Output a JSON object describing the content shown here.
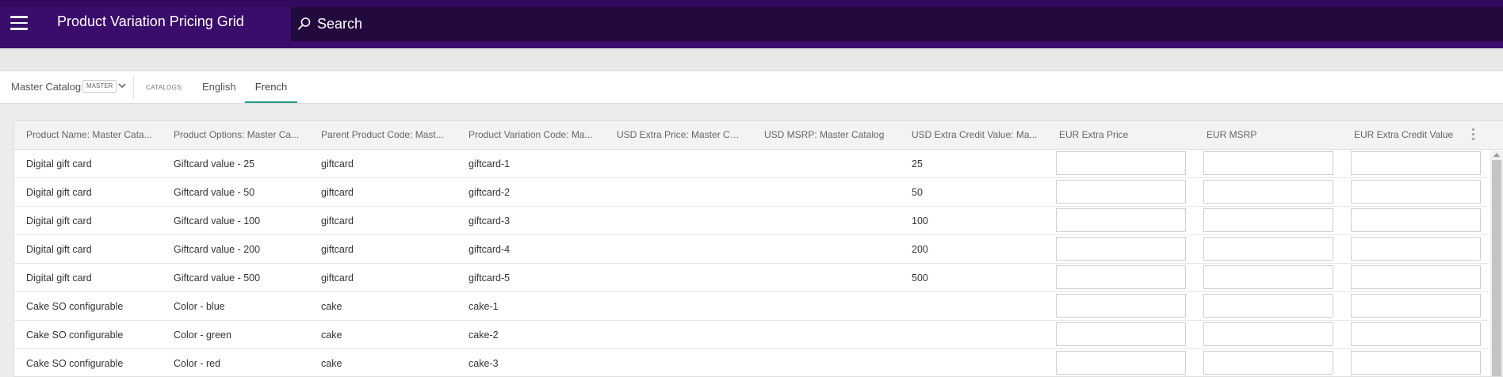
{
  "app": {
    "title": "Product Variation Pricing Grid",
    "search_placeholder": "Search"
  },
  "catalog_bar": {
    "master_catalog": "Master Catalog",
    "master_badge": "MASTER",
    "catalogs_label": "CATALOGS:",
    "tabs": [
      {
        "label": "English",
        "active": false
      },
      {
        "label": "French",
        "active": true
      }
    ]
  },
  "grid": {
    "columns": [
      "Product Name: Master Cata...",
      "Product Options: Master Ca...",
      "Parent Product Code: Mast...",
      "Product Variation Code: Ma...",
      "USD Extra Price: Master Cat...",
      "USD MSRP: Master Catalog",
      "USD Extra Credit Value: Ma...",
      "EUR Extra Price",
      "EUR MSRP",
      "EUR Extra Credit Value"
    ],
    "rows": [
      {
        "name": "Digital gift card",
        "options": "Giftcard value - 25",
        "parent_code": "giftcard",
        "variation_code": "giftcard-1",
        "usd_extra_price": "",
        "usd_msrp": "",
        "usd_extra_credit": "25",
        "eur_extra_price": "",
        "eur_msrp": "",
        "eur_extra_credit": ""
      },
      {
        "name": "Digital gift card",
        "options": "Giftcard value - 50",
        "parent_code": "giftcard",
        "variation_code": "giftcard-2",
        "usd_extra_price": "",
        "usd_msrp": "",
        "usd_extra_credit": "50",
        "eur_extra_price": "",
        "eur_msrp": "",
        "eur_extra_credit": ""
      },
      {
        "name": "Digital gift card",
        "options": "Giftcard value - 100",
        "parent_code": "giftcard",
        "variation_code": "giftcard-3",
        "usd_extra_price": "",
        "usd_msrp": "",
        "usd_extra_credit": "100",
        "eur_extra_price": "",
        "eur_msrp": "",
        "eur_extra_credit": ""
      },
      {
        "name": "Digital gift card",
        "options": "Giftcard value - 200",
        "parent_code": "giftcard",
        "variation_code": "giftcard-4",
        "usd_extra_price": "",
        "usd_msrp": "",
        "usd_extra_credit": "200",
        "eur_extra_price": "",
        "eur_msrp": "",
        "eur_extra_credit": ""
      },
      {
        "name": "Digital gift card",
        "options": "Giftcard value - 500",
        "parent_code": "giftcard",
        "variation_code": "giftcard-5",
        "usd_extra_price": "",
        "usd_msrp": "",
        "usd_extra_credit": "500",
        "eur_extra_price": "",
        "eur_msrp": "",
        "eur_extra_credit": ""
      },
      {
        "name": "Cake SO configurable",
        "options": "Color - blue",
        "parent_code": "cake",
        "variation_code": "cake-1",
        "usd_extra_price": "",
        "usd_msrp": "",
        "usd_extra_credit": "",
        "eur_extra_price": "",
        "eur_msrp": "",
        "eur_extra_credit": ""
      },
      {
        "name": "Cake SO configurable",
        "options": "Color - green",
        "parent_code": "cake",
        "variation_code": "cake-2",
        "usd_extra_price": "",
        "usd_msrp": "",
        "usd_extra_credit": "",
        "eur_extra_price": "",
        "eur_msrp": "",
        "eur_extra_credit": ""
      },
      {
        "name": "Cake SO configurable",
        "options": "Color - red",
        "parent_code": "cake",
        "variation_code": "cake-3",
        "usd_extra_price": "",
        "usd_msrp": "",
        "usd_extra_credit": "",
        "eur_extra_price": "",
        "eur_msrp": "",
        "eur_extra_credit": ""
      }
    ]
  },
  "colors": {
    "topbar": "#3a0c6b",
    "search_bg": "#230a3e",
    "active_tab_underline": "#1e9b8a"
  }
}
